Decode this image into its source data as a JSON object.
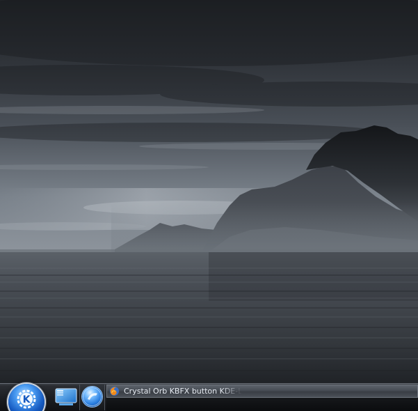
{
  "desktop": {
    "wallpaper": "wallpaper",
    "colors": {
      "sky_dark": "#25282d",
      "sky_light": "#8c939c",
      "water": "#3e4349",
      "mountain": "#121417"
    }
  },
  "panel": {
    "kmenu": {
      "icon": "kde-gear-icon"
    },
    "quicklaunch": [
      {
        "id": "desktop",
        "icon": "show-desktop-icon"
      },
      {
        "id": "browser",
        "icon": "konqueror-globe-icon"
      }
    ],
    "tasks": [
      {
        "icon": "firefox-icon",
        "label": "Crystal Orb KBFX button KDE-Look"
      }
    ],
    "colors": {
      "panel_top": "#3a3e44",
      "panel_bottom": "#101114",
      "task_text": "#e6ebf2",
      "kmenu_blue": "#1559c0"
    }
  }
}
